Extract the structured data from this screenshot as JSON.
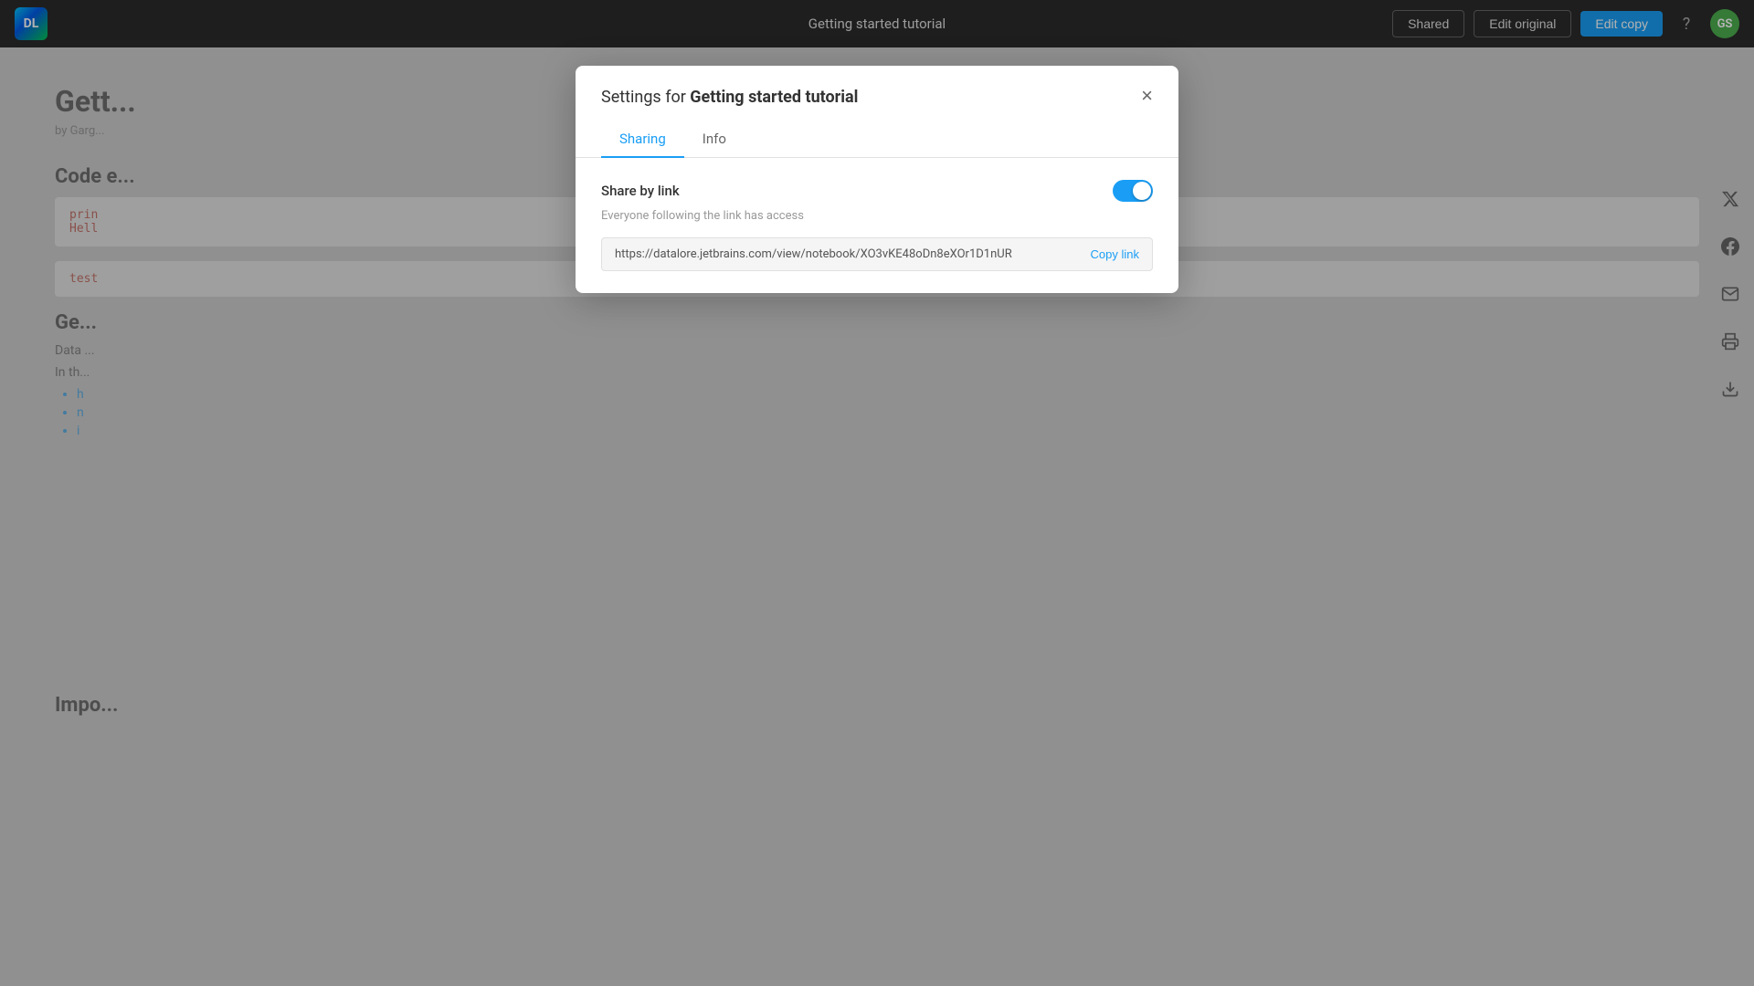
{
  "navbar": {
    "logo_text": "DL",
    "page_title": "Getting started tutorial",
    "shared_btn": "Shared",
    "edit_original_btn": "Edit original",
    "edit_copy_btn": "Edit copy",
    "help_icon": "?",
    "avatar_text": "GS"
  },
  "background": {
    "title": "Gett...",
    "subtitle": "by Garg...",
    "section1_title": "Code e...",
    "code_line1": "prin",
    "code_line2": "Hell",
    "code_test": "test",
    "section2_title": "Ge...",
    "desc": "Data ...",
    "paragraph": "In th...",
    "list_items": [
      "h",
      "n",
      "i"
    ],
    "bottom_section": "Impo..."
  },
  "modal": {
    "title_prefix": "Settings for ",
    "title_name": "Getting started tutorial",
    "close_icon": "×",
    "tabs": [
      {
        "id": "sharing",
        "label": "Sharing",
        "active": true
      },
      {
        "id": "info",
        "label": "Info",
        "active": false
      }
    ],
    "share_by_link_label": "Share by link",
    "toggle_on": true,
    "hint_text": "Everyone following the link has access",
    "link_url": "https://datalore.jetbrains.com/view/notebook/XO3vKE48oDn8eXOr1D1nUR",
    "copy_link_label": "Copy link"
  },
  "sidebar_icons": {
    "twitter": "𝕏",
    "facebook": "f",
    "email": "✉",
    "print": "⎙",
    "download": "⬇"
  }
}
